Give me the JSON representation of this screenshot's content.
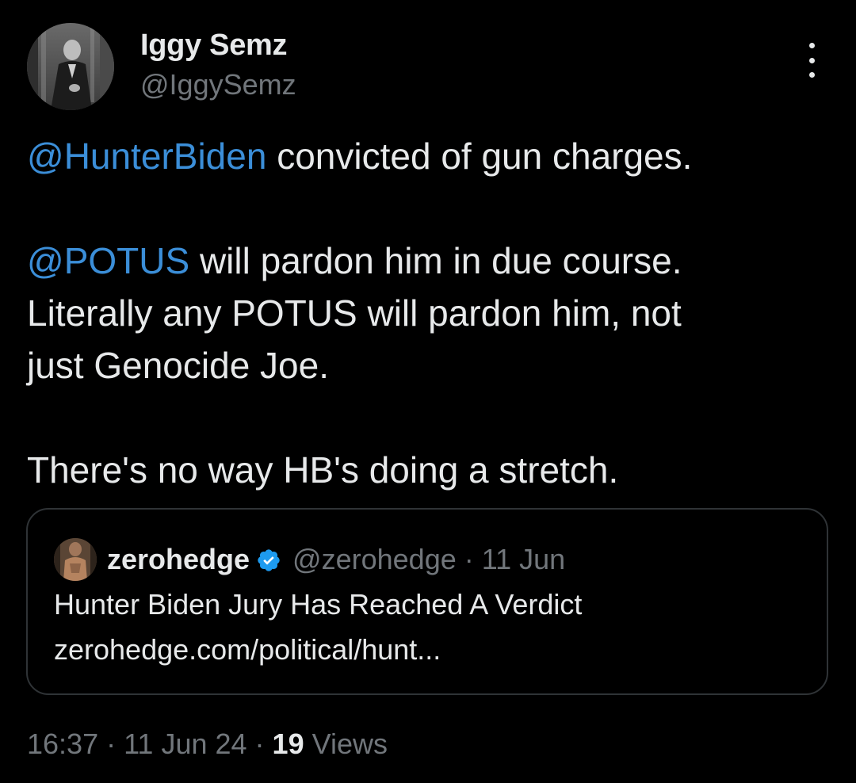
{
  "author": {
    "display_name": "Iggy Semz",
    "handle": "@IggySemz",
    "avatar_icon": "user-photo-avatar"
  },
  "more_icon": "more-vertical-icon",
  "tweet": {
    "line1_mention": "@HunterBiden",
    "line1_text": " convicted of gun charges.",
    "line2_mention": "@POTUS",
    "line2_text": " will pardon him in due course.",
    "line3": "Literally any POTUS will pardon him, not",
    "line4": "just Genocide Joe.",
    "line5": "There's no way HB's doing a stretch."
  },
  "quote": {
    "display_name": "zerohedge",
    "verified_icon": "verified-badge-icon",
    "handle_date": "@zerohedge · 11 Jun",
    "title": "Hunter Biden Jury Has Reached A Verdict",
    "link": "zerohedge.com/political/hunt..."
  },
  "meta": {
    "time_date": "16:37 · 11 Jun 24 · ",
    "view_count": "19",
    "views_label": " Views"
  },
  "colors": {
    "background": "#000000",
    "text": "#e7e9ea",
    "muted": "#71767b",
    "mention": "#3b8ed8",
    "border": "#2f3336",
    "verified": "#1d9bf0"
  }
}
